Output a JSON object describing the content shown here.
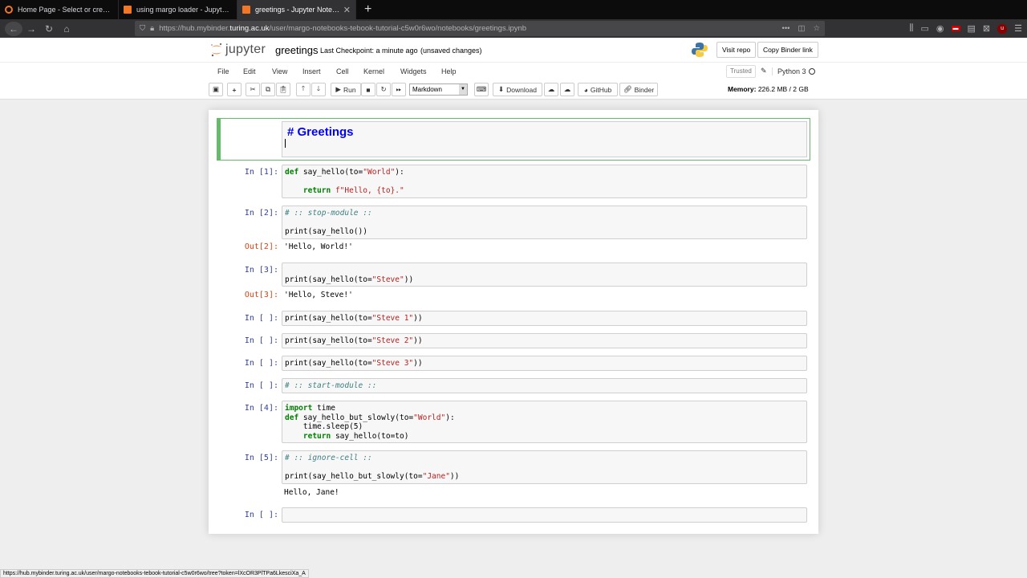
{
  "browser": {
    "tabs": [
      {
        "title": "Home Page - Select or create a",
        "active": false
      },
      {
        "title": "using margo loader - Jupyter N",
        "active": false
      },
      {
        "title": "greetings - Jupyter Notebook",
        "active": true
      }
    ],
    "url_prefix": "https://hub.mybinder.",
    "url_domain": "turing.ac.uk",
    "url_path": "/user/margo-notebooks-tebook-tutorial-c5w0r6wo/notebooks/greetings.ipynb",
    "status_url": "https://hub.mybinder.turing.ac.uk/user/margo-notebooks-tebook-tutorial-c5w0r6wo/tree?token=lXcOR3PlTPa6LkesciXa_A"
  },
  "header": {
    "logo_text": "jupyter",
    "notebook_name": "greetings",
    "checkpoint": "Last Checkpoint: a minute ago",
    "unsaved": "(unsaved changes)",
    "visit_repo": "Visit repo",
    "copy_binder_link": "Copy Binder link"
  },
  "menu": {
    "items": [
      "File",
      "Edit",
      "View",
      "Insert",
      "Cell",
      "Kernel",
      "Widgets",
      "Help"
    ],
    "trusted": "Trusted",
    "kernel": "Python 3"
  },
  "toolbar": {
    "run": "Run",
    "cell_type": "Markdown",
    "download": "Download",
    "github": "GitHub",
    "binder": "Binder",
    "memory_label": "Memory:",
    "memory_value": "226.2 MB / 2 GB"
  },
  "cells": {
    "markdown": "# Greetings",
    "c1": {
      "prompt": "In [1]:"
    },
    "c2": {
      "prompt": "In [2]:",
      "out_prompt": "Out[2]:",
      "output": "'Hello, World!'"
    },
    "c3": {
      "prompt": "In [3]:",
      "out_prompt": "Out[3]:",
      "output": "'Hello, Steve!'"
    },
    "c4": {
      "prompt": "In [ ]:"
    },
    "c5": {
      "prompt": "In [ ]:"
    },
    "c6": {
      "prompt": "In [ ]:"
    },
    "c7": {
      "prompt": "In [ ]:"
    },
    "c8": {
      "prompt": "In [4]:"
    },
    "c9": {
      "prompt": "In [5]:",
      "output": "Hello, Jane!"
    },
    "c10": {
      "prompt": "In [ ]:"
    }
  },
  "code": {
    "c1_l1": [
      "def",
      " say_hello(to=",
      "\"World\"",
      "):"
    ],
    "c1_l2": [
      "    ",
      "return",
      " ",
      "f\"Hello, {to}.\""
    ],
    "c2_l1": "# :: stop-module ::",
    "c2_l2": "print(say_hello())",
    "c3_l2": [
      "print(say_hello(to=",
      "\"Steve\"",
      "))"
    ],
    "c4": [
      "print(say_hello(to=",
      "\"Steve 1\"",
      "))"
    ],
    "c5": [
      "print(say_hello(to=",
      "\"Steve 2\"",
      "))"
    ],
    "c6": [
      "print(say_hello(to=",
      "\"Steve 3\"",
      "))"
    ],
    "c7": "# :: start-module ::",
    "c8_l1": [
      "import",
      " time"
    ],
    "c8_l2": [
      "def",
      " say_hello_but_slowly(to=",
      "\"World\"",
      "):"
    ],
    "c8_l3": "    time.sleep(5)",
    "c8_l4": [
      "    ",
      "return",
      " say_hello(to=to)"
    ],
    "c9_l1": "# :: ignore-cell ::",
    "c9_l3": [
      "print(say_hello_but_slowly(to=",
      "\"Jane\"",
      "))"
    ]
  }
}
